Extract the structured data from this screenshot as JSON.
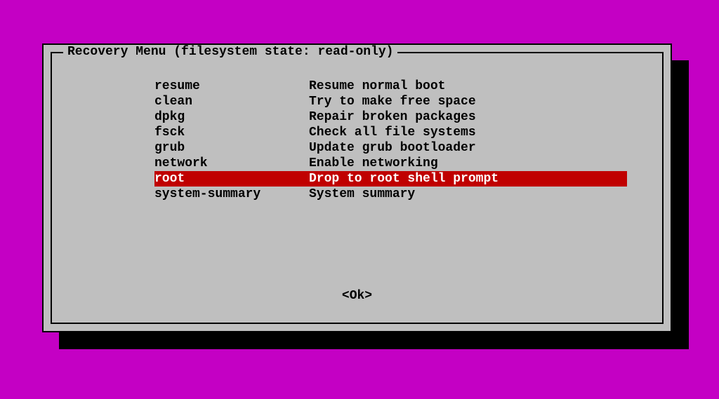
{
  "dialog": {
    "title": "Recovery Menu (filesystem state: read-only)",
    "ok_label": "<Ok>",
    "selected_index": 6,
    "items": [
      {
        "key": "resume",
        "desc": "Resume normal boot"
      },
      {
        "key": "clean",
        "desc": "Try to make free space"
      },
      {
        "key": "dpkg",
        "desc": "Repair broken packages"
      },
      {
        "key": "fsck",
        "desc": "Check all file systems"
      },
      {
        "key": "grub",
        "desc": "Update grub bootloader"
      },
      {
        "key": "network",
        "desc": "Enable networking"
      },
      {
        "key": "root",
        "desc": "Drop to root shell prompt"
      },
      {
        "key": "system-summary",
        "desc": "System summary"
      }
    ]
  },
  "colors": {
    "background": "#c400c4",
    "dialog_bg": "#bfbfbf",
    "selected_bg": "#c00000",
    "selected_fg": "#ffffff",
    "text": "#000000"
  }
}
